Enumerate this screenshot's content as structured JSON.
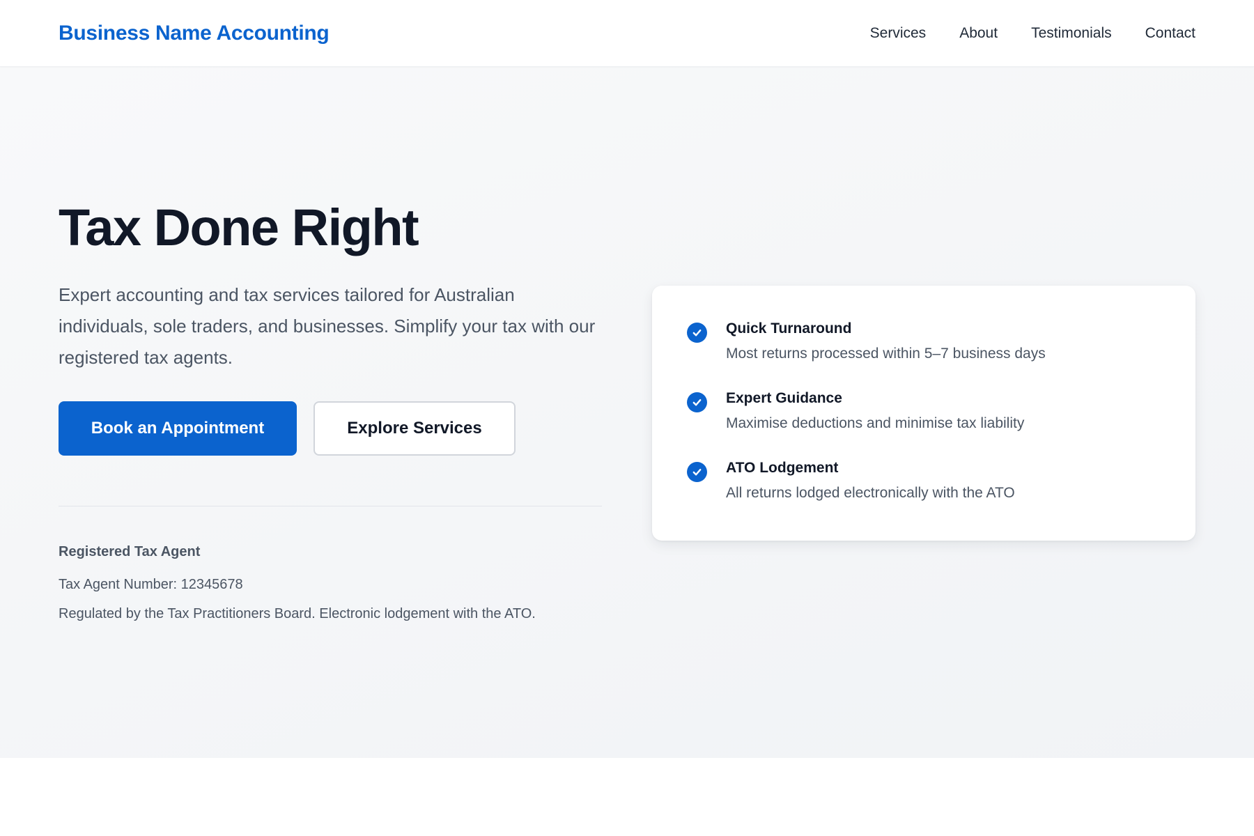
{
  "header": {
    "brand": "Business Name Accounting",
    "nav": [
      {
        "label": "Services"
      },
      {
        "label": "About"
      },
      {
        "label": "Testimonials"
      },
      {
        "label": "Contact"
      }
    ]
  },
  "hero": {
    "title": "Tax Done Right",
    "subtitle": "Expert accounting and tax services tailored for Australian individuals, sole traders, and businesses. Simplify your tax with our registered tax agents.",
    "primary_button": "Book an Appointment",
    "secondary_button": "Explore Services"
  },
  "agent": {
    "heading": "Registered Tax Agent",
    "number": "Tax Agent Number: 12345678",
    "regulation": "Regulated by the Tax Practitioners Board. Electronic lodgement with the ATO."
  },
  "features": [
    {
      "title": "Quick Turnaround",
      "description": "Most returns processed within 5–7 business days",
      "icon": "check-circle-icon"
    },
    {
      "title": "Expert Guidance",
      "description": "Maximise deductions and minimise tax liability",
      "icon": "check-circle-icon"
    },
    {
      "title": "ATO Lodgement",
      "description": "All returns lodged electronically with the ATO",
      "icon": "check-circle-icon"
    }
  ],
  "colors": {
    "brand": "#0b63ce",
    "heading": "#111827",
    "body_text": "#4b5563",
    "hero_background": "#f3f4f6"
  }
}
